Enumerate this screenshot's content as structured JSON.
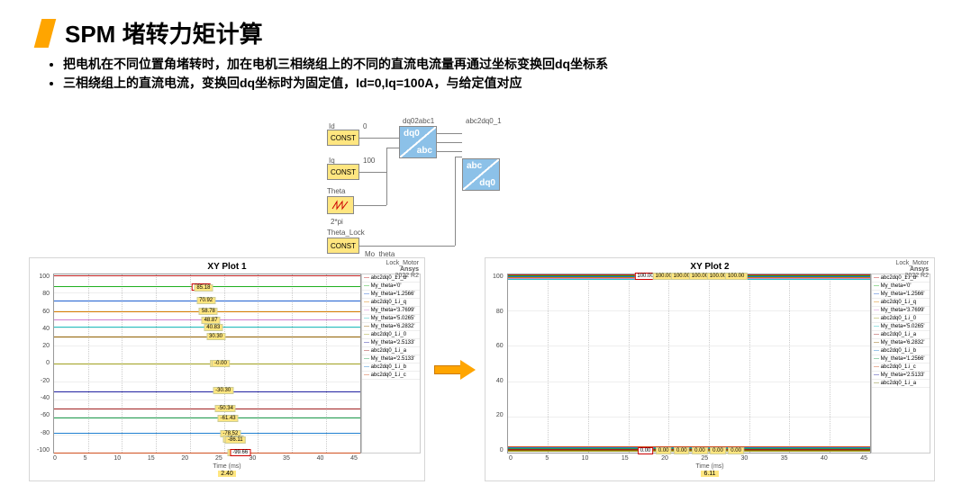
{
  "title": "SPM 堵转力矩计算",
  "bullets": [
    "把电机在不同位置角堵转时，加在电机三相绕组上的不同的直流电流量再通过坐标变换回dq坐标系",
    "三相绕组上的直流电流，变换回dq坐标时为固定值，Id=0,Iq=100A，与给定值对应"
  ],
  "diagram": {
    "const1": "CONST",
    "const2": "CONST",
    "const3": "CONST",
    "block1_label": "dq02abc1",
    "block2_label": "abc2dq0_1",
    "dq0": "dq0",
    "abc": "abc",
    "in_id": "Id",
    "in_iq": "Iq",
    "in_v0": "0",
    "in_v100": "100",
    "theta": "Theta",
    "gain": "2*pi",
    "theta_lock": "Theta_Lock",
    "out": "Mo_theta"
  },
  "chart_data": [
    {
      "type": "line",
      "title": "XY Plot 1",
      "corner_label": "Lock_Motor",
      "brand": "Ansys",
      "brand_ver": "2022 R2",
      "xlabel": "Time (ms)",
      "x_highlight": "2.40",
      "x_ticks": [
        "0",
        "5",
        "10",
        "15",
        "20",
        "25",
        "30",
        "35",
        "40",
        "45"
      ],
      "y_ticks": [
        "-100",
        "-80",
        "-60",
        "-40",
        "-20",
        "0",
        "20",
        "40",
        "60",
        "80",
        "100"
      ],
      "ylim": [
        -100,
        100
      ],
      "series": [
        {
          "name": "abc2dq0_1.i_d",
          "y": 99,
          "color": "#c02020"
        },
        {
          "name": "My_theta='0'",
          "y": 87,
          "color": "#20b020"
        },
        {
          "name": "My_theta='1.2566'",
          "y": 71,
          "color": "#2060d0"
        },
        {
          "name": "abc2dq0_1.i_q",
          "y": 59,
          "color": "#d97e00"
        },
        {
          "name": "My_theta='3.7699'",
          "y": 49,
          "color": "#d07fd0"
        },
        {
          "name": "My_theta='5.0265'",
          "y": 41,
          "color": "#20c0c0"
        },
        {
          "name": "My_theta='6.2832'",
          "y": 30,
          "color": "#906000"
        },
        {
          "name": "abc2dq0_1.i_0",
          "y": 0,
          "color": "#a0a020"
        },
        {
          "name": "My_theta='2.5133'",
          "y": -31,
          "color": "#2020a0"
        },
        {
          "name": "abc2dq0_1.i_a",
          "y": -50,
          "color": "#a02020"
        },
        {
          "name": "My_theta='2.5133'",
          "y": -61,
          "color": "#20a050"
        },
        {
          "name": "abc2dq0_1.i_b",
          "y": -78,
          "color": "#2080d0"
        },
        {
          "name": "abc2dq0_1.i_c",
          "y": -100,
          "color": "#d05020"
        }
      ],
      "markers": [
        "86.11",
        "85.18",
        "70.92",
        "58.78",
        "48.87",
        "40.83",
        "30.30",
        "0.00",
        "-0.00",
        "-30.30",
        "-50.34",
        "-61.43",
        "-78.52",
        "-85.18",
        "-86.11",
        "-99.66",
        "-99.66"
      ]
    },
    {
      "type": "line",
      "title": "XY Plot 2",
      "corner_label": "Lock_Motor",
      "brand": "Ansys",
      "brand_ver": "2022 R2",
      "xlabel": "Time (ms)",
      "x_highlight": "6.11",
      "x_ticks": [
        "0",
        "5",
        "10",
        "15",
        "20",
        "25",
        "30",
        "35",
        "40",
        "45"
      ],
      "y_ticks": [
        "0",
        "20",
        "40",
        "60",
        "80",
        "100"
      ],
      "ylim": [
        0,
        100
      ],
      "series_top": {
        "y": 100,
        "colors": [
          "#c02020",
          "#20b020",
          "#2060d0",
          "#d97e00",
          "#d07fd0",
          "#20c0c0"
        ]
      },
      "series_bottom": {
        "y": 0,
        "colors": [
          "#a0a020",
          "#906000",
          "#a02020",
          "#20a050",
          "#2080d0",
          "#d05020"
        ]
      },
      "markers_top": [
        "100.00",
        "100.00",
        "100.00",
        "100.00",
        "100.00",
        "100.00"
      ],
      "markers_bottom": [
        "0.00",
        "0.00",
        "0.00",
        "0.00",
        "0.00",
        "0.00"
      ],
      "legend": [
        "abc2dq0_1.i_d",
        "My_theta='0'",
        "My_theta='1.2566'",
        "abc2dq0_1.i_q",
        "My_theta='3.7699'",
        "abc2dq0_1.i_0",
        "My_theta='5.0265'",
        "abc2dq0_1.i_a",
        "My_theta='6.2832'",
        "abc2dq0_1.i_b",
        "My_theta='1.2566'",
        "abc2dq0_1.i_c",
        "My_theta='2.5133'",
        "abc2dq0_1.i_a"
      ]
    }
  ]
}
